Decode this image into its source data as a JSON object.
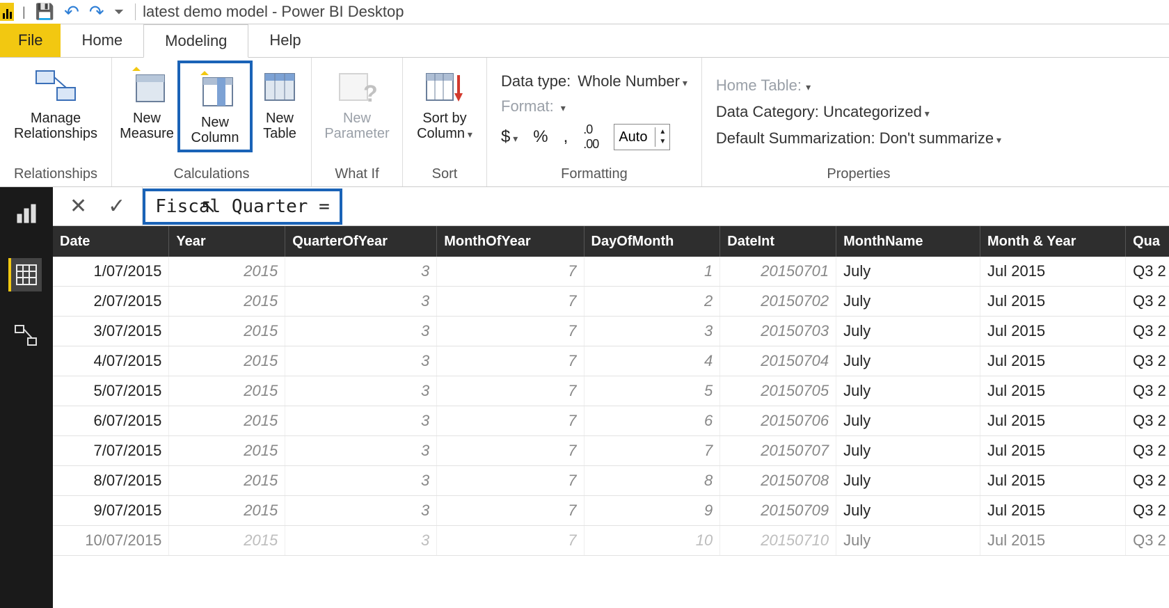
{
  "window_title": "latest demo model - Power BI Desktop",
  "tabs": {
    "file": "File",
    "home": "Home",
    "modeling": "Modeling",
    "help": "Help"
  },
  "ribbon": {
    "relationships": {
      "manage": "Manage\nRelationships",
      "group": "Relationships"
    },
    "calculations": {
      "measure": "New\nMeasure",
      "column": "New\nColumn",
      "table": "New\nTable",
      "group": "Calculations"
    },
    "whatif": {
      "param": "New\nParameter",
      "group": "What If"
    },
    "sort": {
      "sortby": "Sort by\nColumn",
      "group": "Sort"
    },
    "formatting": {
      "datatype_label": "Data type:",
      "datatype_value": "Whole Number",
      "format_label": "Format:",
      "decimals_value": "Auto",
      "group": "Formatting",
      "currency": "$",
      "percent": "%",
      "thousand": ","
    },
    "properties": {
      "hometable_label": "Home Table:",
      "datacategory_label": "Data Category:",
      "datacategory_value": "Uncategorized",
      "summarization_label": "Default Summarization:",
      "summarization_value": "Don't summarize",
      "group": "Properties"
    }
  },
  "formula": {
    "text": "Fiscal Quarter ="
  },
  "grid": {
    "columns": [
      "Date",
      "Year",
      "QuarterOfYear",
      "MonthOfYear",
      "DayOfMonth",
      "DateInt",
      "MonthName",
      "Month & Year",
      "Qua"
    ],
    "rows": [
      {
        "Date": "1/07/2015",
        "Year": "2015",
        "QuarterOfYear": "3",
        "MonthOfYear": "7",
        "DayOfMonth": "1",
        "DateInt": "20150701",
        "MonthName": "July",
        "MonthYear": "Jul 2015",
        "Q": "Q3 2"
      },
      {
        "Date": "2/07/2015",
        "Year": "2015",
        "QuarterOfYear": "3",
        "MonthOfYear": "7",
        "DayOfMonth": "2",
        "DateInt": "20150702",
        "MonthName": "July",
        "MonthYear": "Jul 2015",
        "Q": "Q3 2"
      },
      {
        "Date": "3/07/2015",
        "Year": "2015",
        "QuarterOfYear": "3",
        "MonthOfYear": "7",
        "DayOfMonth": "3",
        "DateInt": "20150703",
        "MonthName": "July",
        "MonthYear": "Jul 2015",
        "Q": "Q3 2"
      },
      {
        "Date": "4/07/2015",
        "Year": "2015",
        "QuarterOfYear": "3",
        "MonthOfYear": "7",
        "DayOfMonth": "4",
        "DateInt": "20150704",
        "MonthName": "July",
        "MonthYear": "Jul 2015",
        "Q": "Q3 2"
      },
      {
        "Date": "5/07/2015",
        "Year": "2015",
        "QuarterOfYear": "3",
        "MonthOfYear": "7",
        "DayOfMonth": "5",
        "DateInt": "20150705",
        "MonthName": "July",
        "MonthYear": "Jul 2015",
        "Q": "Q3 2"
      },
      {
        "Date": "6/07/2015",
        "Year": "2015",
        "QuarterOfYear": "3",
        "MonthOfYear": "7",
        "DayOfMonth": "6",
        "DateInt": "20150706",
        "MonthName": "July",
        "MonthYear": "Jul 2015",
        "Q": "Q3 2"
      },
      {
        "Date": "7/07/2015",
        "Year": "2015",
        "QuarterOfYear": "3",
        "MonthOfYear": "7",
        "DayOfMonth": "7",
        "DateInt": "20150707",
        "MonthName": "July",
        "MonthYear": "Jul 2015",
        "Q": "Q3 2"
      },
      {
        "Date": "8/07/2015",
        "Year": "2015",
        "QuarterOfYear": "3",
        "MonthOfYear": "7",
        "DayOfMonth": "8",
        "DateInt": "20150708",
        "MonthName": "July",
        "MonthYear": "Jul 2015",
        "Q": "Q3 2"
      },
      {
        "Date": "9/07/2015",
        "Year": "2015",
        "QuarterOfYear": "3",
        "MonthOfYear": "7",
        "DayOfMonth": "9",
        "DateInt": "20150709",
        "MonthName": "July",
        "MonthYear": "Jul 2015",
        "Q": "Q3 2"
      },
      {
        "Date": "10/07/2015",
        "Year": "2015",
        "QuarterOfYear": "3",
        "MonthOfYear": "7",
        "DayOfMonth": "10",
        "DateInt": "20150710",
        "MonthName": "July",
        "MonthYear": "Jul 2015",
        "Q": "Q3 2"
      }
    ]
  }
}
